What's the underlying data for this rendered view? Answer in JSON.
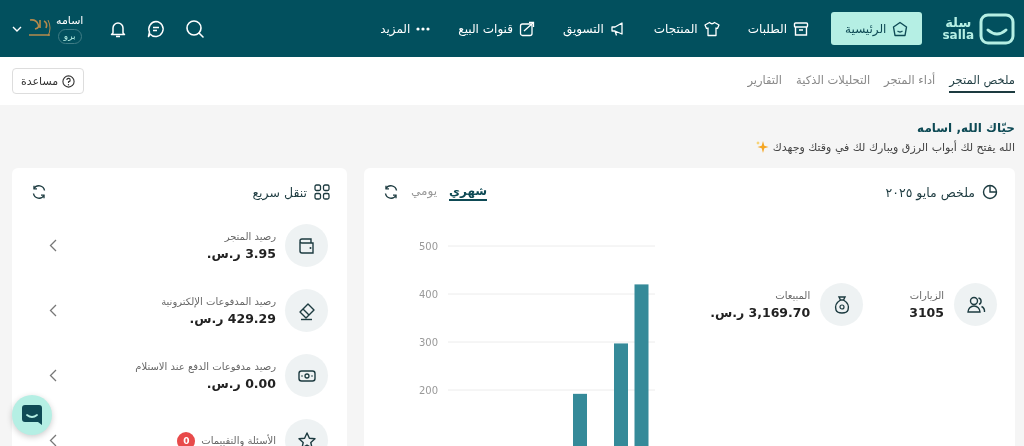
{
  "brand": {
    "name_ar": "سلة",
    "name_en": "salla"
  },
  "nav": [
    {
      "label": "الرئيسية",
      "selected": true
    },
    {
      "label": "الطلبات",
      "selected": false
    },
    {
      "label": "المنتجات",
      "selected": false
    },
    {
      "label": "التسويق",
      "selected": false
    },
    {
      "label": "قنوات البيع",
      "selected": false
    },
    {
      "label": "المزيد",
      "selected": false
    }
  ],
  "user": {
    "name": "اسامه",
    "plan": "برو"
  },
  "tabs": [
    {
      "label": "ملخص المتجر",
      "selected": true
    },
    {
      "label": "أداء المتجر",
      "selected": false
    },
    {
      "label": "التحليلات الذكية",
      "selected": false
    },
    {
      "label": "التقارير",
      "selected": false
    }
  ],
  "help_button": "مساعدة",
  "greeting": {
    "title": "حيّاك الله,  اسامه",
    "subtitle": "الله يفتح لك أبواب الرزق ويبارك لك في وقتك وجهدك"
  },
  "summary": {
    "title": "ملخص مايو ٢٠٢٥",
    "periods": [
      {
        "label": "شهري",
        "selected": true
      },
      {
        "label": "يومي",
        "selected": false
      }
    ],
    "stats": [
      {
        "label": "الزيارات",
        "value": "3105"
      },
      {
        "label": "المبيعات",
        "value": "3,169.70 ر.س."
      }
    ],
    "chart_data": {
      "type": "bar",
      "grid": true,
      "ylim": [
        0,
        500
      ],
      "yticks": [
        200,
        300,
        400,
        500
      ],
      "series": [
        {
          "color": "#358a99",
          "values": [
            null,
            null,
            null,
            null,
            null,
            null,
            192,
            null,
            297,
            420
          ]
        }
      ]
    }
  },
  "quick_nav": {
    "title": "تنقل سريع",
    "items": [
      {
        "label": "رصيد المتجر",
        "value": "3.95 ر.س."
      },
      {
        "label": "رصيد المدفوعات الإلكترونية",
        "value": "429.29 ر.س."
      },
      {
        "label": "رصيد مدفوعات الدفع عند الاستلام",
        "value": "0.00 ر.س."
      },
      {
        "label": "الأسئلة والتقييمات",
        "badge": "0"
      }
    ]
  }
}
